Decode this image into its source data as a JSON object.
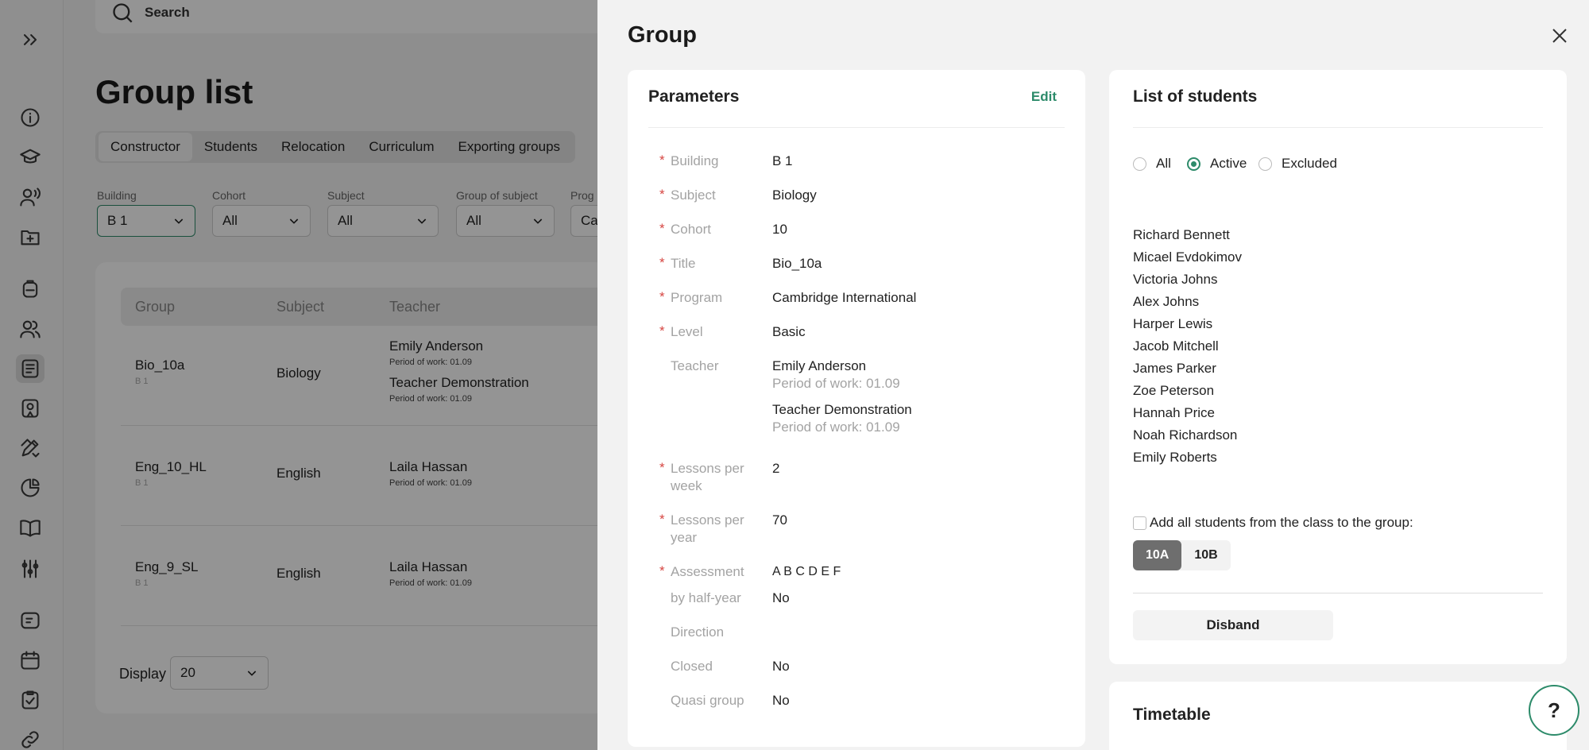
{
  "search": {
    "placeholder": "Search"
  },
  "page": {
    "title": "Group list"
  },
  "tabs": [
    {
      "label": "Constructor",
      "active": true
    },
    {
      "label": "Students"
    },
    {
      "label": "Relocation"
    },
    {
      "label": "Curriculum"
    },
    {
      "label": "Exporting groups"
    }
  ],
  "filters": [
    {
      "label": "Building",
      "value": "B 1"
    },
    {
      "label": "Cohort",
      "value": "All"
    },
    {
      "label": "Subject",
      "value": "All"
    },
    {
      "label": "Group of subject",
      "value": "All"
    },
    {
      "label": "Prog",
      "value": "Ca"
    }
  ],
  "table": {
    "headers": [
      "Group",
      "Subject",
      "Teacher"
    ],
    "rows": [
      {
        "group": "Bio_10a",
        "building": "B 1",
        "subject": "Biology",
        "teachers": [
          {
            "name": "Emily Anderson",
            "period": "Period of work: 01.09"
          },
          {
            "name": "Teacher Demonstration",
            "period": "Period of work: 01.09"
          }
        ]
      },
      {
        "group": "Eng_10_HL",
        "building": "B 1",
        "subject": "English",
        "teachers": [
          {
            "name": "Laila Hassan",
            "period": "Period of work: 01.09"
          }
        ]
      },
      {
        "group": "Eng_9_SL",
        "building": "B 1",
        "subject": "English",
        "teachers": [
          {
            "name": "Laila Hassan",
            "period": "Period of work: 01.09"
          }
        ]
      }
    ]
  },
  "display": {
    "label": "Display",
    "value": "20"
  },
  "drawer": {
    "title": "Group",
    "parameters": {
      "title": "Parameters",
      "edit_label": "Edit",
      "fields": {
        "building": {
          "label": "Building",
          "value": "B 1"
        },
        "subject": {
          "label": "Subject",
          "value": "Biology"
        },
        "cohort": {
          "label": "Cohort",
          "value": "10"
        },
        "title": {
          "label": "Title",
          "value": "Bio_10a"
        },
        "program": {
          "label": "Program",
          "value": "Cambridge International"
        },
        "level": {
          "label": "Level",
          "value": "Basic"
        },
        "teacher": {
          "label": "Teacher",
          "t1_name": "Emily Anderson",
          "t1_period": "Period of work: 01.09",
          "t2_name": "Teacher Demonstration",
          "t2_period": "Period of work: 01.09"
        },
        "lessons_week": {
          "label": "Lessons per week",
          "value": "2"
        },
        "lessons_year": {
          "label": "Lessons per year",
          "value": "70"
        },
        "assessment": {
          "label": "Assessment",
          "value": "A B C D E F"
        },
        "half_year": {
          "label": "by half-year",
          "value": "No"
        },
        "direction": {
          "label": "Direction",
          "value": ""
        },
        "closed": {
          "label": "Closed",
          "value": "No"
        },
        "quasi": {
          "label": "Quasi group",
          "value": "No"
        }
      }
    },
    "students": {
      "title": "List of students",
      "filters": {
        "all": "All",
        "active": "Active",
        "excluded": "Excluded"
      },
      "selected_filter": "Active",
      "names": [
        "Richard Bennett",
        "Micael Evdokimov",
        "Victoria Johns",
        "Alex Johns",
        "Harper Lewis",
        "Jacob Mitchell",
        "James Parker",
        "Zoe Peterson",
        "Hannah Price",
        "Noah Richardson",
        "Emily Roberts"
      ],
      "add_all_label": "Add all students from the class to the group:",
      "classes": [
        "10A",
        "10B"
      ],
      "selected_class": "10A",
      "disband_label": "Disband"
    },
    "timetable": {
      "title": "Timetable"
    }
  },
  "help": {
    "label": "?"
  },
  "colors": {
    "accent": "#2d8b6a",
    "required": "#d64541"
  }
}
